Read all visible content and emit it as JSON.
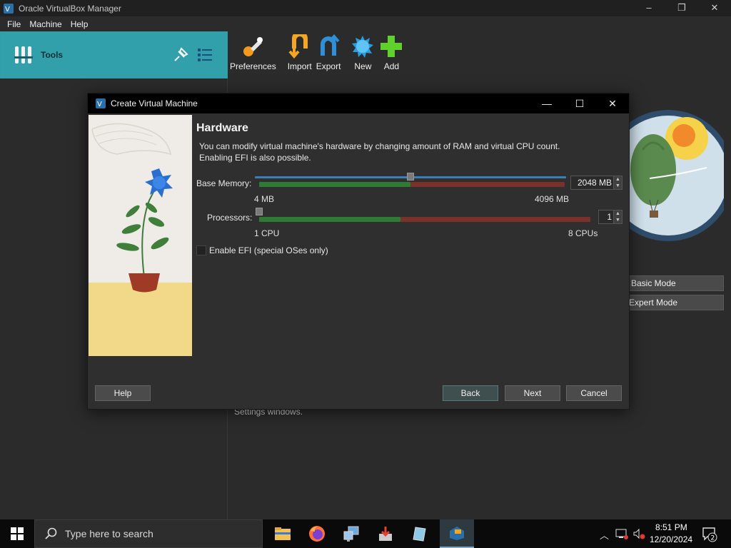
{
  "window": {
    "title": "Oracle VirtualBox Manager",
    "controls": [
      "–",
      "❐",
      "✕"
    ]
  },
  "menu": {
    "items": [
      "File",
      "Machine",
      "Help"
    ]
  },
  "tools_panel": {
    "label": "Tools"
  },
  "toolbar": {
    "preferences": "Preferences",
    "import": "Import",
    "export": "Export",
    "new": "New",
    "add": "Add"
  },
  "right_panel": {
    "basic_mode": "Basic Mode",
    "expert_mode": "Expert Mode",
    "settings_text": "Settings windows."
  },
  "dialog": {
    "title": "Create Virtual Machine",
    "controls": [
      "—",
      "☐",
      "✕"
    ],
    "section_title": "Hardware",
    "description": "You can modify virtual machine's hardware by changing amount of RAM and virtual CPU count. Enabling EFI is also possible.",
    "memory": {
      "label": "Base Memory:",
      "value": "2048 MB",
      "min_label": "4 MB",
      "max_label": "4096 MB",
      "fraction": 0.5
    },
    "processors": {
      "label": "Processors:",
      "value": "1",
      "min_label": "1 CPU",
      "max_label": "8 CPUs",
      "fraction": 0.0
    },
    "efi": {
      "label": "Enable EFI (special OSes only)",
      "checked": false
    },
    "buttons": {
      "help": "Help",
      "back": "Back",
      "next": "Next",
      "cancel": "Cancel"
    }
  },
  "taskbar": {
    "search_placeholder": "Type here to search",
    "time": "8:51 PM",
    "date": "12/20/2024",
    "notification_count": "2"
  },
  "colors": {
    "accent_teal": "#32a0aa",
    "slider_green": "#2f7a35",
    "slider_red": "#7a3129"
  }
}
